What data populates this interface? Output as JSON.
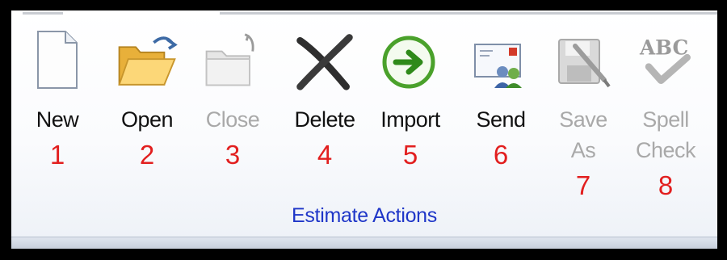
{
  "group": {
    "title": "Estimate Actions"
  },
  "buttons": [
    {
      "label": "New",
      "number": "1",
      "icon": "new-document-icon",
      "enabled": true
    },
    {
      "label": "Open",
      "number": "2",
      "icon": "open-folder-icon",
      "enabled": true
    },
    {
      "label": "Close",
      "number": "3",
      "icon": "close-folder-icon",
      "enabled": false
    },
    {
      "label": "Delete",
      "number": "4",
      "icon": "delete-x-icon",
      "enabled": true
    },
    {
      "label": "Import",
      "number": "5",
      "icon": "import-arrow-icon",
      "enabled": true
    },
    {
      "label": "Send",
      "number": "6",
      "icon": "send-envelope-icon",
      "enabled": true
    },
    {
      "label_line1": "Save",
      "label_line2": "As",
      "number": "7",
      "icon": "save-as-icon",
      "enabled": false
    },
    {
      "label_line1": "Spell",
      "label_line2": "Check",
      "number": "8",
      "icon": "spell-check-icon",
      "enabled": false
    }
  ],
  "colors": {
    "number": "#e21f1f",
    "group_label": "#1f36c8",
    "disabled_text": "#a9a9a9"
  }
}
